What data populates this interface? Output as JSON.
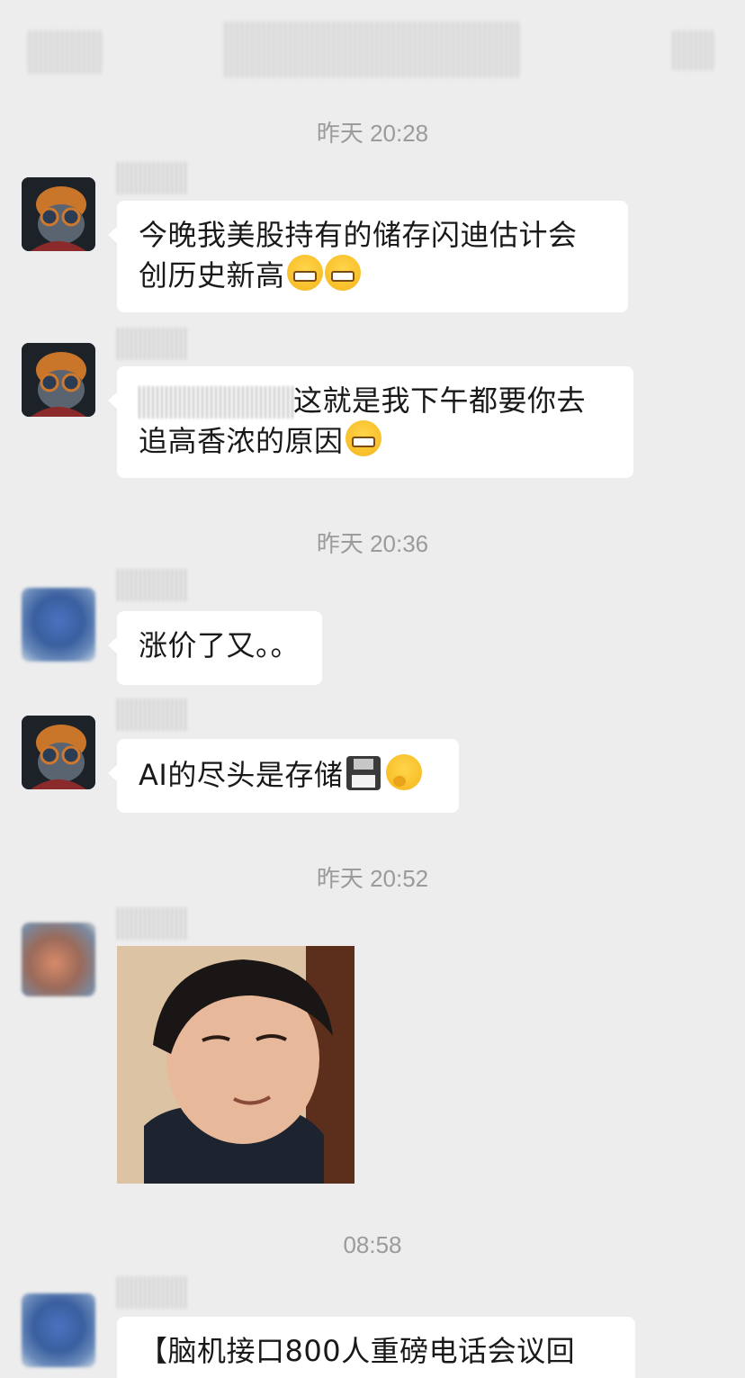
{
  "timestamps": {
    "t1": "昨天 20:28",
    "t2": "昨天 20:36",
    "t3": "昨天 20:52",
    "t4": "08:58"
  },
  "messages": {
    "m1": {
      "line1": "今晚我美股持有的储存闪迪估计会",
      "line2": "创历史新高"
    },
    "m2": {
      "line1": "这就是我下午都要你去",
      "line2": "追高香浓的原因"
    },
    "m3": {
      "text": "涨价了又。。"
    },
    "m4": {
      "text": "AI的尽头是存储"
    },
    "m5": {
      "text": "【脑机接口800人重磅电话会议回"
    }
  },
  "icons": {
    "grin": "grinning-face-icon",
    "floppy": "floppy-disk-icon",
    "thinking": "thinking-face-icon"
  },
  "colors": {
    "background": "#ededed",
    "bubble": "#ffffff",
    "timestamp": "#9b9b9b",
    "text": "#191919"
  }
}
